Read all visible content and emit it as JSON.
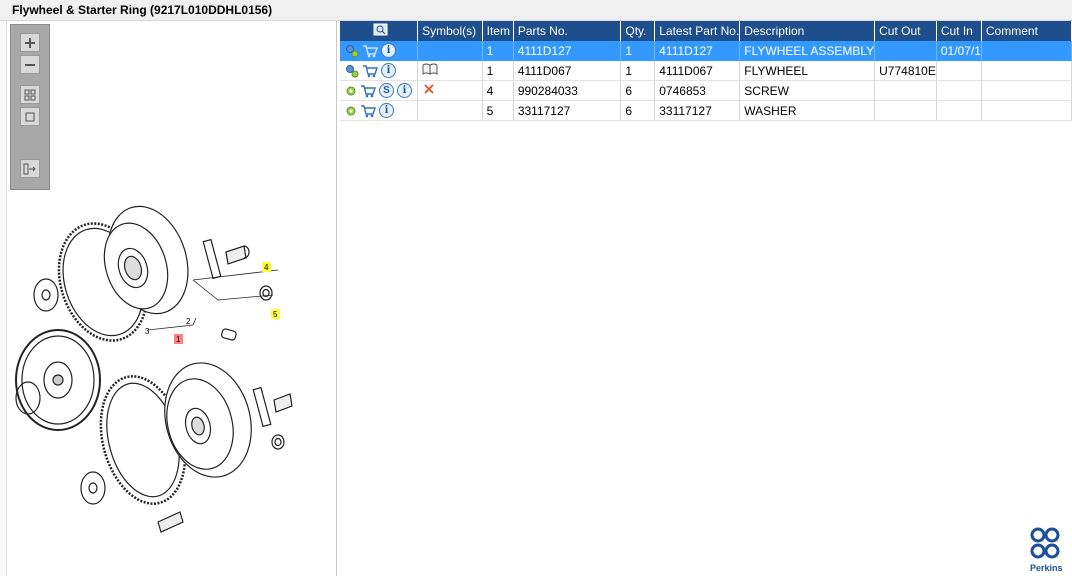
{
  "window": {
    "title": "Flywheel & Starter Ring (9217L010DDHL0156)"
  },
  "toolbox": {
    "buttons": [
      "zoom-in",
      "zoom-out",
      "fit-all",
      "actual-size",
      "export"
    ]
  },
  "drawing": {
    "callouts": [
      "1",
      "2",
      "3",
      "4",
      "5"
    ]
  },
  "table": {
    "columns": [
      "",
      "Symbol(s)",
      "Item",
      "Parts No.",
      "Qty.",
      "Latest Part No.",
      "Description",
      "Cut Out",
      "Cut In",
      "Comment"
    ],
    "rows": [
      {
        "item": "1",
        "parts_no": "4111D127",
        "qty": "1",
        "latest": "4111D127",
        "description": "FLYWHEEL ASSEMBLY",
        "cut_out": "",
        "cut_in": "01/07/1",
        "comment": "",
        "selected": true,
        "symbol": "",
        "icons": [
          "gears-icon",
          "cart-icon",
          "info-icon"
        ]
      },
      {
        "item": "1",
        "parts_no": "4111D067",
        "qty": "1",
        "latest": "4111D067",
        "description": "FLYWHEEL",
        "cut_out": "U774810E",
        "cut_in": "",
        "comment": "",
        "selected": false,
        "symbol": "book-icon",
        "icons": [
          "gears-icon",
          "cart-icon",
          "info-icon"
        ]
      },
      {
        "item": "4",
        "parts_no": "990284033",
        "qty": "6",
        "latest": "0746853",
        "description": "SCREW",
        "cut_out": "",
        "cut_in": "",
        "comment": "",
        "selected": false,
        "symbol": "cross-icon",
        "icons": [
          "gear-icon",
          "cart-icon",
          "s-badge-icon",
          "info-icon"
        ]
      },
      {
        "item": "5",
        "parts_no": "33117127",
        "qty": "6",
        "latest": "33117127",
        "description": "WASHER",
        "cut_out": "",
        "cut_in": "",
        "comment": "",
        "selected": false,
        "symbol": "",
        "icons": [
          "gear-icon",
          "cart-icon",
          "info-icon"
        ]
      }
    ]
  },
  "brand": {
    "name": "Perkins",
    "color": "#1d4e9a"
  },
  "colors": {
    "header": "#1f4e8c",
    "selection": "#3399ff"
  }
}
